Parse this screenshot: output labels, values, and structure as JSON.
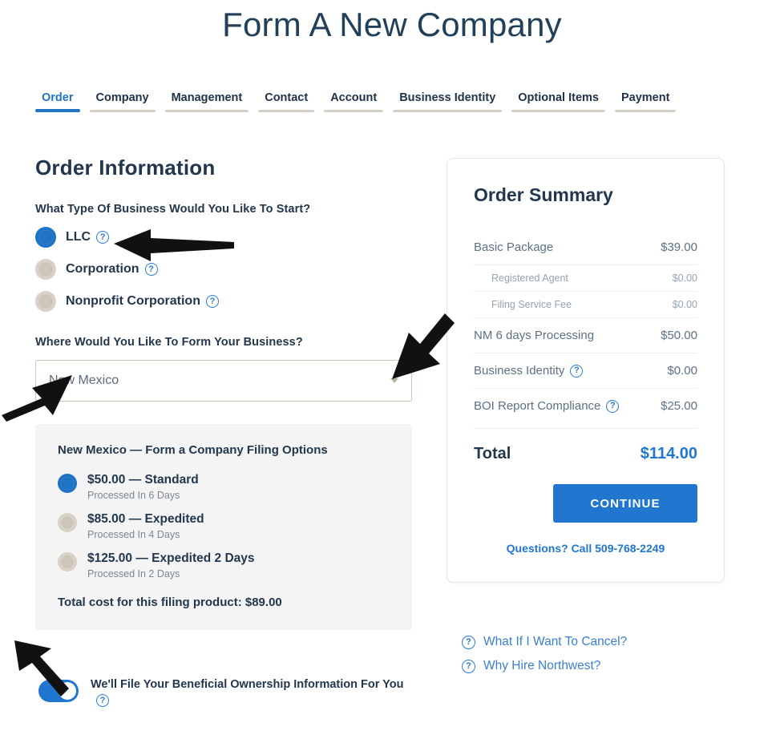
{
  "page": {
    "title": "Form A New Company"
  },
  "tabs": [
    {
      "label": "Order",
      "active": true
    },
    {
      "label": "Company",
      "active": false
    },
    {
      "label": "Management",
      "active": false
    },
    {
      "label": "Contact",
      "active": false
    },
    {
      "label": "Account",
      "active": false
    },
    {
      "label": "Business Identity",
      "active": false
    },
    {
      "label": "Optional Items",
      "active": false
    },
    {
      "label": "Payment",
      "active": false
    }
  ],
  "order_information": {
    "heading": "Order Information",
    "business_type_label": "What Type Of Business Would You Like To Start?",
    "business_types": [
      {
        "label": "LLC",
        "selected": true,
        "help": "?"
      },
      {
        "label": "Corporation",
        "selected": false,
        "help": "?"
      },
      {
        "label": "Nonprofit Corporation",
        "selected": false,
        "help": "?"
      }
    ],
    "state_label": "Where Would You Like To Form Your Business?",
    "state_value": "New Mexico",
    "state_caret": "chevron-down"
  },
  "filing_options": {
    "title": "New Mexico — Form a Company Filing Options",
    "options": [
      {
        "price": "$50.00",
        "name": "— Standard",
        "main": "$50.00 — Standard",
        "sub": "Processed In 6 Days",
        "selected": true
      },
      {
        "price": "$85.00",
        "name": "— Expedited",
        "main": "$85.00 — Expedited",
        "sub": "Processed In 4 Days",
        "selected": false
      },
      {
        "price": "$125.00",
        "name": "— Expedited 2 Days",
        "main": "$125.00 — Expedited 2 Days",
        "sub": "Processed In 2 Days",
        "selected": false
      }
    ],
    "total_text": "Total cost for this filing product: $89.00"
  },
  "boi_toggle": {
    "label": "We'll File Your Beneficial Ownership Information For You",
    "help": "?",
    "enabled": true
  },
  "order_summary": {
    "title": "Order Summary",
    "rows": [
      {
        "label": "Basic Package",
        "value": "$39.00",
        "sub": false,
        "help": false
      },
      {
        "label": "Registered Agent",
        "value": "$0.00",
        "sub": true,
        "help": false
      },
      {
        "label": "Filing Service Fee",
        "value": "$0.00",
        "sub": true,
        "help": false
      },
      {
        "label": "NM 6 days Processing",
        "value": "$50.00",
        "sub": false,
        "help": false
      },
      {
        "label": "Business Identity",
        "value": "$0.00",
        "sub": false,
        "help": true
      },
      {
        "label": "BOI Report Compliance",
        "value": "$25.00",
        "sub": false,
        "help": true
      }
    ],
    "total_label": "Total",
    "total_value": "$114.00",
    "continue_label": "CONTINUE",
    "questions_text": "Questions? Call 509-768-2249"
  },
  "help_links": [
    {
      "label": "What If I Want To Cancel?",
      "icon": "?"
    },
    {
      "label": "Why Hire Northwest?",
      "icon": "?"
    }
  ],
  "colors": {
    "accent_blue": "#2176cf",
    "dark_navy": "#22374d",
    "muted_slate": "#5c7186",
    "tab_inactive_underline": "#d6cfc5",
    "filing_box_bg": "#f4f4f4",
    "radio_unselected": "#d9d2c8"
  }
}
